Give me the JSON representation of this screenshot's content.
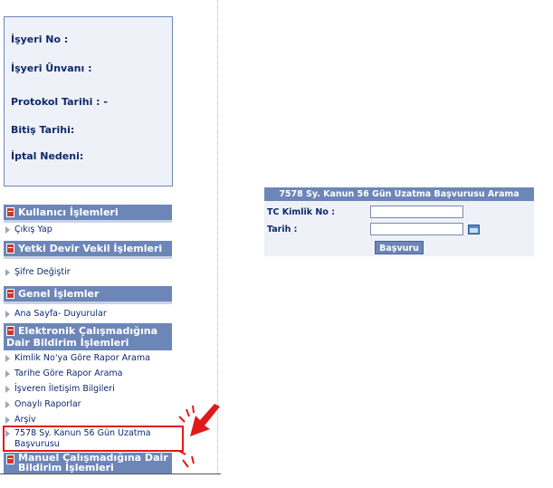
{
  "info": {
    "isyeri_no": "İşyeri No :",
    "isyeri_unvani": "İşyeri Ünvanı :",
    "protokol_tarihi": "Protokol Tarihi : -",
    "bitis_tarihi": "Bitiş Tarihi:",
    "iptal_nedeni": "İptal Nedeni:"
  },
  "menu": {
    "sections": [
      {
        "title": "Kullanıcı İşlemleri",
        "items": [
          "Çıkış Yap"
        ]
      },
      {
        "title": "Yetki Devir Vekil İşlemleri",
        "items": [
          "Şifre Değiştir"
        ]
      },
      {
        "title": "Genel İşlemler",
        "items": [
          "Ana Sayfa- Duyurular"
        ]
      },
      {
        "title_line1": "Elektronik Çalışmadığına",
        "title_line2": "Dair Bildirim İşlemleri",
        "items": [
          "Kimlik No'ya Göre Rapor Arama",
          "Tarihe Göre Rapor Arama",
          "İşveren İletişim Bilgileri",
          "Onaylı Raporlar",
          "Arşiv"
        ],
        "highlighted_line1": "7578 Sy. Kanun 56 Gün Uzatma",
        "highlighted_line2": "Başvurusu"
      },
      {
        "title_line1": "Manuel Çalışmadığına Dair",
        "title_line2": "Bildirim İşlemleri"
      }
    ]
  },
  "form": {
    "title": "7578 Sy. Kanun 56 Gün Uzatma Başvurusu Arama",
    "tc_label": "TC Kimlik No :",
    "tc_value": "",
    "tarih_label": "Tarih :",
    "tarih_value": "",
    "submit_label": "Başvuru"
  },
  "colors": {
    "header_bg": "#6d86b8",
    "highlight": "#e01a1a",
    "text": "#0d2a6e"
  }
}
